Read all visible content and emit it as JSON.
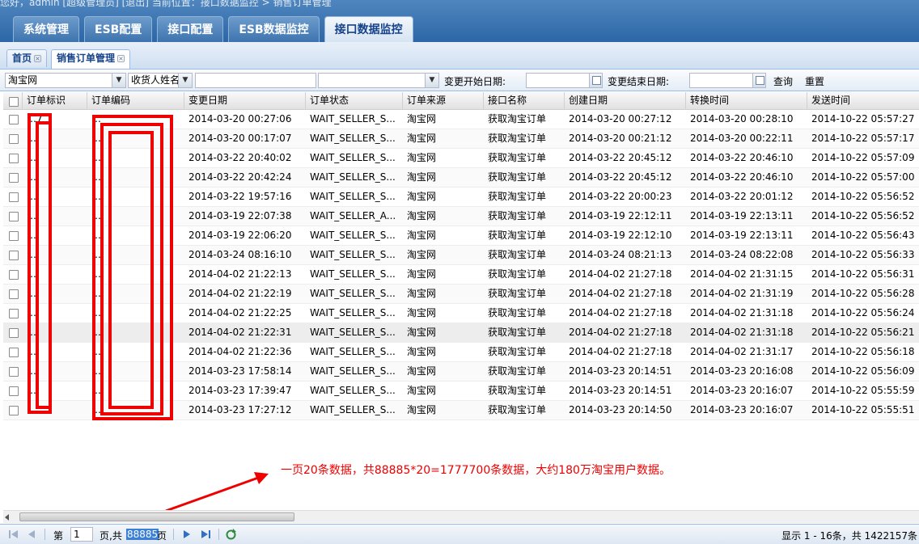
{
  "header": {
    "top_text": "您好，admin [超级管理员]  [退出]    当前位置：接口数据监控 > 销售订单管理"
  },
  "main_tabs": [
    {
      "label": "系统管理"
    },
    {
      "label": "ESB配置"
    },
    {
      "label": "接口配置"
    },
    {
      "label": "ESB数据监控"
    },
    {
      "label": "接口数据监控"
    }
  ],
  "page_tabs": [
    {
      "label": "首页"
    },
    {
      "label": "销售订单管理"
    }
  ],
  "toolbar": {
    "source_value": "淘宝网",
    "field_select_value": "收货人姓名",
    "start_date_label": "变更开始日期:",
    "end_date_label": "变更结束日期:",
    "query_label": "查询",
    "reset_label": "重置"
  },
  "columns": [
    "订单标识",
    "订单编码",
    "变更日期",
    "订单状态",
    "订单来源",
    "接口名称",
    "创建日期",
    "转换时间",
    "发送时间"
  ],
  "rows": [
    {
      "id": "…7",
      "code": "…",
      "change": "2014-03-20 00:27:06",
      "status": "WAIT_SELLER_S...",
      "source": "淘宝网",
      "iface": "获取淘宝订单",
      "created": "2014-03-20 00:27:12",
      "convert": "2014-03-20 00:28:10",
      "send": "2014-10-22 05:57:27"
    },
    {
      "id": "…",
      "code": "…",
      "change": "2014-03-20 00:17:07",
      "status": "WAIT_SELLER_S...",
      "source": "淘宝网",
      "iface": "获取淘宝订单",
      "created": "2014-03-20 00:21:12",
      "convert": "2014-03-20 00:22:11",
      "send": "2014-10-22 05:57:17"
    },
    {
      "id": "…",
      "code": "…",
      "change": "2014-03-22 20:40:02",
      "status": "WAIT_SELLER_S...",
      "source": "淘宝网",
      "iface": "获取淘宝订单",
      "created": "2014-03-22 20:45:12",
      "convert": "2014-03-22 20:46:10",
      "send": "2014-10-22 05:57:09"
    },
    {
      "id": "…",
      "code": "…",
      "change": "2014-03-22 20:42:24",
      "status": "WAIT_SELLER_S...",
      "source": "淘宝网",
      "iface": "获取淘宝订单",
      "created": "2014-03-22 20:45:12",
      "convert": "2014-03-22 20:46:10",
      "send": "2014-10-22 05:57:00"
    },
    {
      "id": "…",
      "code": "…",
      "change": "2014-03-22 19:57:16",
      "status": "WAIT_SELLER_S...",
      "source": "淘宝网",
      "iface": "获取淘宝订单",
      "created": "2014-03-22 20:00:23",
      "convert": "2014-03-22 20:01:12",
      "send": "2014-10-22 05:56:52"
    },
    {
      "id": "…",
      "code": "…",
      "change": "2014-03-19 22:07:38",
      "status": "WAIT_SELLER_A...",
      "source": "淘宝网",
      "iface": "获取淘宝订单",
      "created": "2014-03-19 22:12:11",
      "convert": "2014-03-19 22:13:11",
      "send": "2014-10-22 05:56:52"
    },
    {
      "id": "…",
      "code": "…",
      "change": "2014-03-19 22:06:20",
      "status": "WAIT_SELLER_S...",
      "source": "淘宝网",
      "iface": "获取淘宝订单",
      "created": "2014-03-19 22:12:10",
      "convert": "2014-03-19 22:13:11",
      "send": "2014-10-22 05:56:43"
    },
    {
      "id": "…",
      "code": "…",
      "change": "2014-03-24 08:16:10",
      "status": "WAIT_SELLER_S...",
      "source": "淘宝网",
      "iface": "获取淘宝订单",
      "created": "2014-03-24 08:21:13",
      "convert": "2014-03-24 08:22:08",
      "send": "2014-10-22 05:56:33"
    },
    {
      "id": "…",
      "code": "…",
      "change": "2014-04-02 21:22:13",
      "status": "WAIT_SELLER_S...",
      "source": "淘宝网",
      "iface": "获取淘宝订单",
      "created": "2014-04-02 21:27:18",
      "convert": "2014-04-02 21:31:15",
      "send": "2014-10-22 05:56:31"
    },
    {
      "id": "…",
      "code": "…",
      "change": "2014-04-02 21:22:19",
      "status": "WAIT_SELLER_S...",
      "source": "淘宝网",
      "iface": "获取淘宝订单",
      "created": "2014-04-02 21:27:18",
      "convert": "2014-04-02 21:31:19",
      "send": "2014-10-22 05:56:28"
    },
    {
      "id": "…",
      "code": "…",
      "change": "2014-04-02 21:22:25",
      "status": "WAIT_SELLER_S...",
      "source": "淘宝网",
      "iface": "获取淘宝订单",
      "created": "2014-04-02 21:27:18",
      "convert": "2014-04-02 21:31:18",
      "send": "2014-10-22 05:56:24"
    },
    {
      "id": "…",
      "code": "…",
      "change": "2014-04-02 21:22:31",
      "status": "WAIT_SELLER_S...",
      "source": "淘宝网",
      "iface": "获取淘宝订单",
      "created": "2014-04-02 21:27:18",
      "convert": "2014-04-02 21:31:18",
      "send": "2014-10-22 05:56:21"
    },
    {
      "id": "…",
      "code": "…",
      "change": "2014-04-02 21:22:36",
      "status": "WAIT_SELLER_S...",
      "source": "淘宝网",
      "iface": "获取淘宝订单",
      "created": "2014-04-02 21:27:18",
      "convert": "2014-04-02 21:31:17",
      "send": "2014-10-22 05:56:18"
    },
    {
      "id": "…",
      "code": "…",
      "change": "2014-03-23 17:58:14",
      "status": "WAIT_SELLER_S...",
      "source": "淘宝网",
      "iface": "获取淘宝订单",
      "created": "2014-03-23 20:14:51",
      "convert": "2014-03-23 20:16:08",
      "send": "2014-10-22 05:56:09"
    },
    {
      "id": "…",
      "code": "…",
      "change": "2014-03-23 17:39:47",
      "status": "WAIT_SELLER_S...",
      "source": "淘宝网",
      "iface": "获取淘宝订单",
      "created": "2014-03-23 20:14:51",
      "convert": "2014-03-23 20:16:07",
      "send": "2014-10-22 05:55:59"
    },
    {
      "id": "…",
      "code": "…",
      "change": "2014-03-23 17:27:12",
      "status": "WAIT_SELLER_S...",
      "source": "淘宝网",
      "iface": "获取淘宝订单",
      "created": "2014-03-23 20:14:50",
      "convert": "2014-03-23 20:16:07",
      "send": "2014-10-22 05:55:51"
    }
  ],
  "annotation": "一页20条数据，共88885*20=1777700条数据，大约180万淘宝用户数据。",
  "pager": {
    "page_label": "第",
    "page_value": "1",
    "of_label": "页,共",
    "total_pages": "88885",
    "pages_suffix": "页",
    "info": "显示 1 - 16条，共 1422157条"
  },
  "colors": {
    "accent": "#3d73ae",
    "annotation": "#ee0000"
  }
}
